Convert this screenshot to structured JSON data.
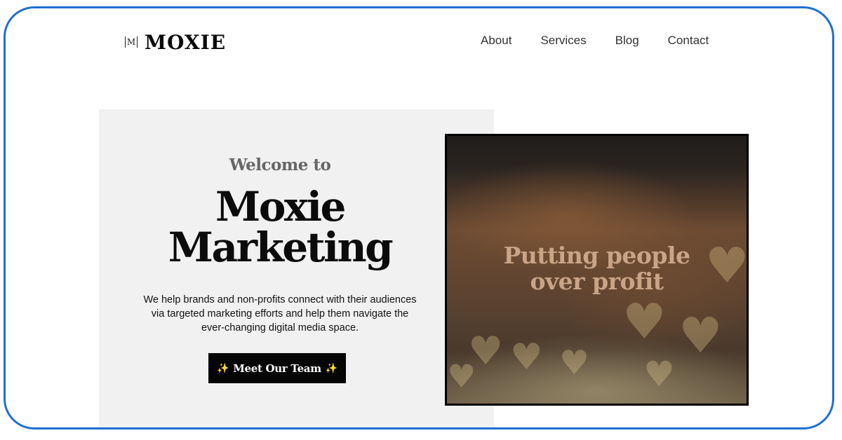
{
  "header": {
    "logo_mark": "M",
    "logo_text": "MOXIE",
    "nav": [
      "About",
      "Services",
      "Blog",
      "Contact"
    ]
  },
  "hero": {
    "welcome": "Welcome to",
    "headline_line1": "Moxie",
    "headline_line2": "Marketing",
    "description": "We help brands and non-profits connect with their audiences via targeted marketing efforts and help them navigate the ever-changing digital media space.",
    "cta_label": "Meet Our Team",
    "cta_sparkle": "✨"
  },
  "image": {
    "caption_line1": "Putting people",
    "caption_line2": "over profit"
  },
  "colors": {
    "frame_border": "#1f6fd1",
    "panel_bg": "#f1f1f1",
    "cta_bg": "#050505",
    "caption": "#c9a487"
  }
}
